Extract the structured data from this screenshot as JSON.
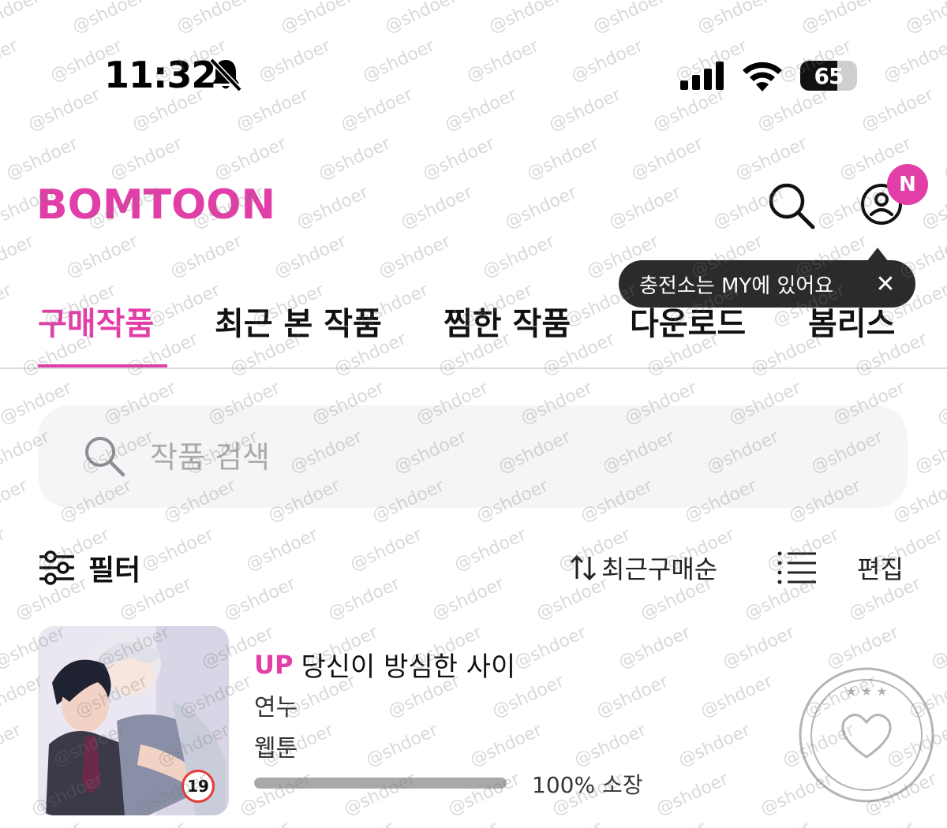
{
  "status_bar": {
    "time": "11:32",
    "battery_level": "65",
    "icons": [
      "bell-mute-icon",
      "signal-icon",
      "wifi-icon",
      "battery-icon"
    ]
  },
  "header": {
    "logo": "BOMTOON",
    "notification_badge": "N",
    "icons": [
      "search-icon",
      "profile-icon"
    ]
  },
  "tooltip": {
    "text": "충전소는 MY에 있어요",
    "close": "✕"
  },
  "tabs": [
    {
      "label": "구매작품",
      "active": true
    },
    {
      "label": "최근 본 작품",
      "active": false
    },
    {
      "label": "찜한 작품",
      "active": false
    },
    {
      "label": "다운로드",
      "active": false
    },
    {
      "label": "봄리스",
      "active": false
    }
  ],
  "search": {
    "placeholder": "작품 검색"
  },
  "toolbar": {
    "filter_label": "필터",
    "sort_label": "최근구매순",
    "edit_label": "편집"
  },
  "items": [
    {
      "badge": "UP",
      "title": "당신이 방심한 사이",
      "author": "연누",
      "type": "웹툰",
      "age_rating": "19",
      "progress_percent": 100,
      "progress_text": "100% 소장"
    }
  ],
  "watermark": {
    "text": "@shdoer",
    "stamp_text": "소장완료"
  },
  "colors": {
    "brand": "#e23ea8",
    "tooltip_bg": "#2b2b2b",
    "search_bg": "#f5f5f7"
  }
}
